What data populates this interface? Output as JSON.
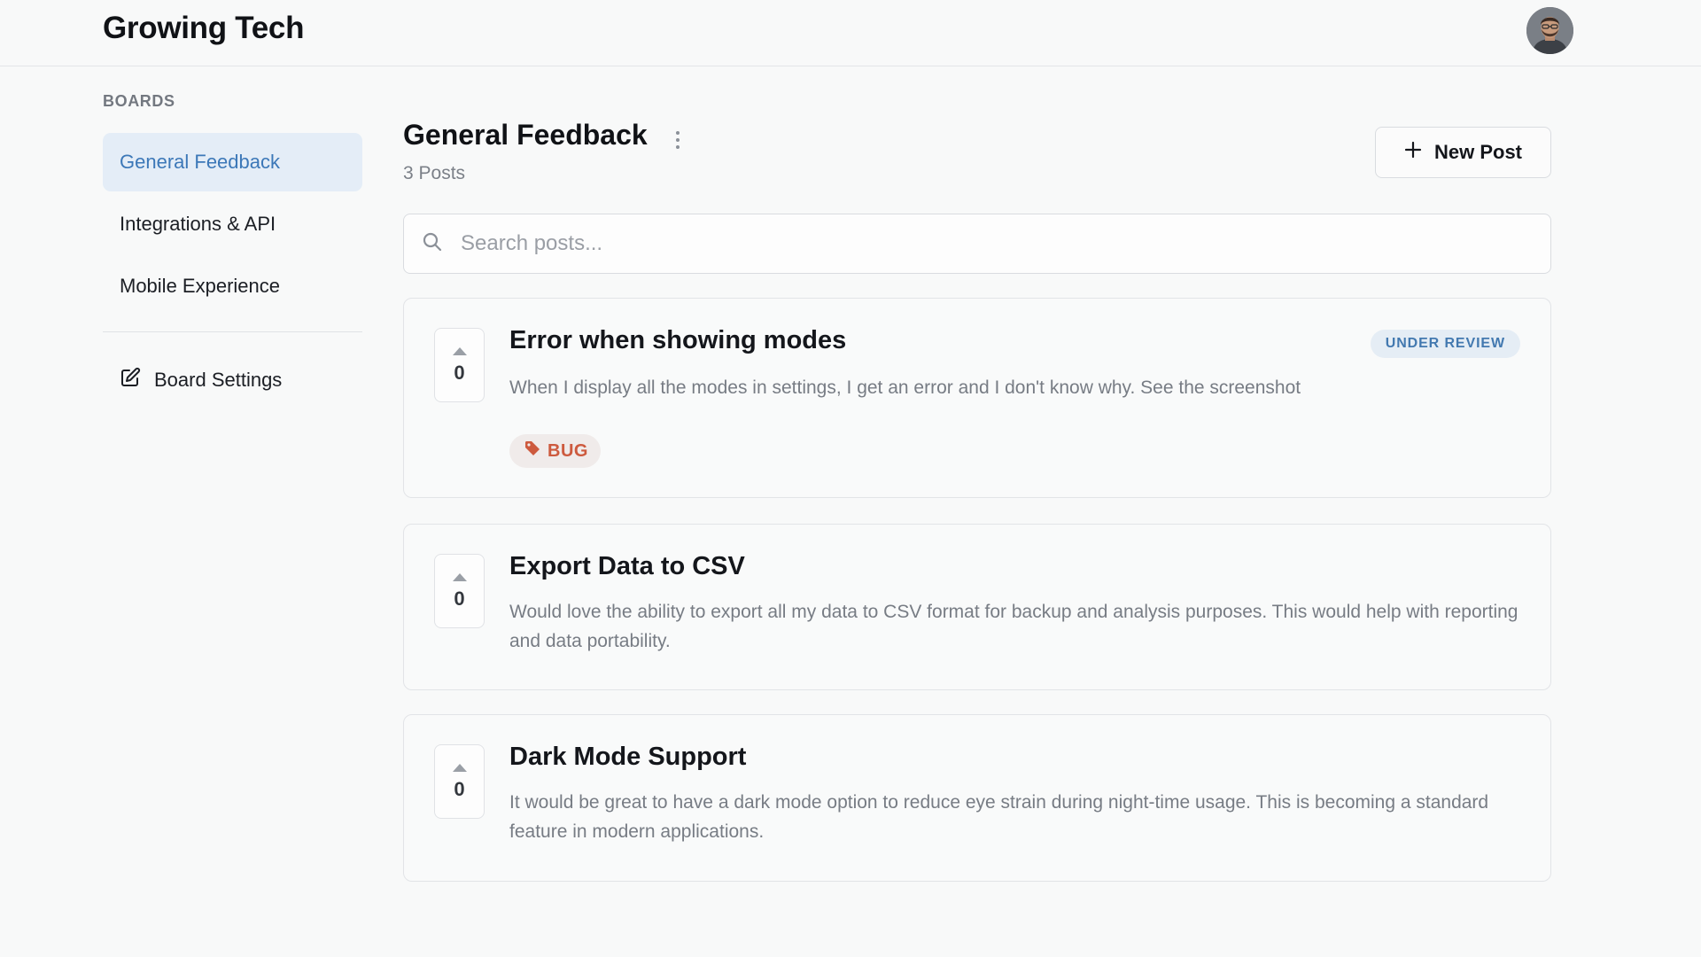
{
  "app": {
    "title": "Growing Tech",
    "avatar_icon": "user-avatar-icon"
  },
  "sidebar": {
    "section_label": "BOARDS",
    "items": [
      {
        "label": "General Feedback",
        "active": true
      },
      {
        "label": "Integrations & API",
        "active": false
      },
      {
        "label": "Mobile Experience",
        "active": false
      }
    ],
    "settings_label": "Board Settings",
    "settings_icon": "edit-icon"
  },
  "main": {
    "board_title": "General Feedback",
    "post_count": "3 Posts",
    "new_post_label": "New Post",
    "new_post_icon": "plus-icon",
    "menu_icon": "more-vertical-icon",
    "search": {
      "placeholder": "Search posts...",
      "value": "",
      "icon": "search-icon"
    },
    "posts": [
      {
        "votes": "0",
        "title": "Error when showing modes",
        "description": "When I display all the modes in settings, I get an error and I don't know why. See the screenshot",
        "status": "UNDER REVIEW",
        "tag": "BUG"
      },
      {
        "votes": "0",
        "title": "Export Data to CSV",
        "description": "Would love the ability to export all my data to CSV format for backup and analysis purposes. This would help with reporting and data portability."
      },
      {
        "votes": "0",
        "title": "Dark Mode Support",
        "description": "It would be great to have a dark mode option to reduce eye strain during night-time usage. This is becoming a standard feature in modern applications."
      }
    ]
  },
  "colors": {
    "background": "#f8f9f9",
    "accent": "#3c78b8",
    "active_item_bg": "#e4edf7",
    "status_under_review_bg": "#e5edf5",
    "status_under_review_text": "#4379b0",
    "tag_bug_bg": "#f0ebea",
    "tag_bug_text": "#cd5a3e"
  }
}
